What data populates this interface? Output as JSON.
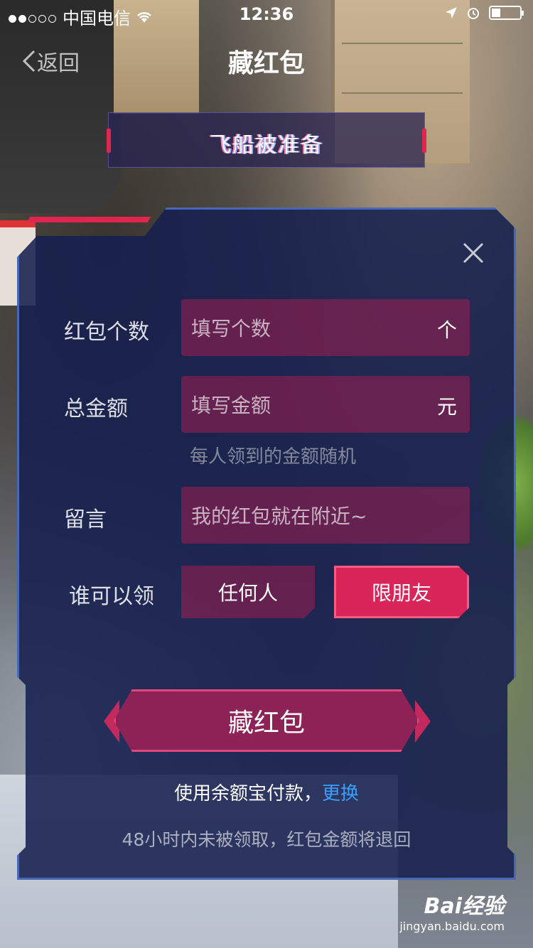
{
  "status_bar": {
    "carrier": "中国电信",
    "time": "12:36"
  },
  "nav": {
    "back_label": "返回",
    "title": "藏红包"
  },
  "banner": {
    "text": "飞船被准备"
  },
  "form": {
    "count": {
      "label": "红包个数",
      "placeholder": "填写个数",
      "unit": "个"
    },
    "amount": {
      "label": "总金额",
      "placeholder": "填写金额",
      "unit": "元",
      "hint": "每人领到的金额随机"
    },
    "message": {
      "label": "留言",
      "placeholder": "我的红包就在附近~"
    },
    "who": {
      "label": "谁可以领",
      "options": [
        "任何人",
        "限朋友"
      ],
      "selected": "限朋友"
    }
  },
  "submit_label": "藏红包",
  "payment": {
    "text": "使用余额宝付款，",
    "change_link": "更换"
  },
  "notice": "48小时内未被领取，红包金额将退回",
  "watermark": {
    "brand": "Bai经验",
    "url": "jingyan.baidu.com"
  },
  "colors": {
    "accent": "#d8265a",
    "panel": "#16204e",
    "link": "#3aa0ff"
  }
}
